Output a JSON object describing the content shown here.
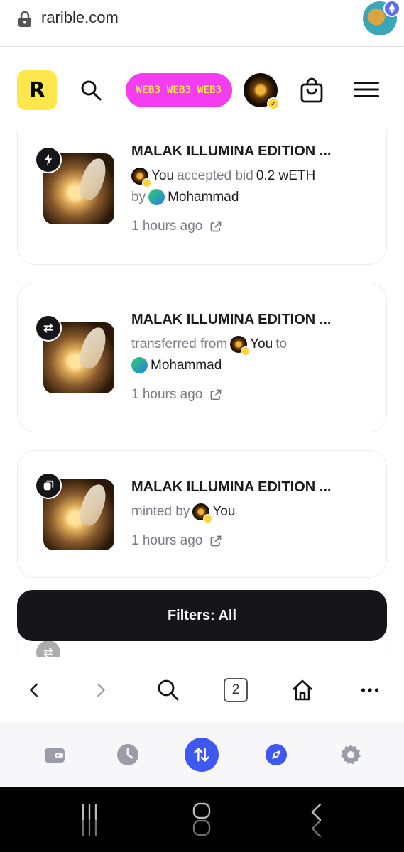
{
  "browser": {
    "url": "rarible.com",
    "tab_count": "2"
  },
  "header": {
    "logo_letter": "R",
    "marquee_text": "WEB3 WEB3 WEB3"
  },
  "activities": [
    {
      "type": "accepted-bid",
      "title": "MALAK ILLUMINA EDITION ...",
      "actor": "You",
      "action": "accepted bid",
      "amount": "0.2 wETH",
      "by_label": "by",
      "counterparty": "Mohammad",
      "time": "1 hours ago"
    },
    {
      "type": "transfer",
      "title": "MALAK ILLUMINA EDITION ...",
      "action": "transferred from",
      "actor": "You",
      "to_label": "to",
      "counterparty": "Mohammad",
      "time": "1 hours ago"
    },
    {
      "type": "mint",
      "title": "MALAK ILLUMINA EDITION ...",
      "action": "minted by",
      "actor": "You",
      "time": "1 hours ago"
    }
  ],
  "filters_label": "Filters: All",
  "colors": {
    "brand_yellow": "#fde74c",
    "pill_pink": "#f43cf0",
    "pill_text": "#ffe94a",
    "accent_blue": "#4058f2",
    "dark": "#15151a"
  },
  "icons": {
    "browser_nav": [
      "back-icon",
      "forward-icon",
      "search-icon",
      "tabs-icon",
      "home-icon",
      "more-icon"
    ],
    "wallet_bar": [
      "wallet-icon",
      "history-icon",
      "swap-icon",
      "discover-icon",
      "settings-icon"
    ]
  }
}
